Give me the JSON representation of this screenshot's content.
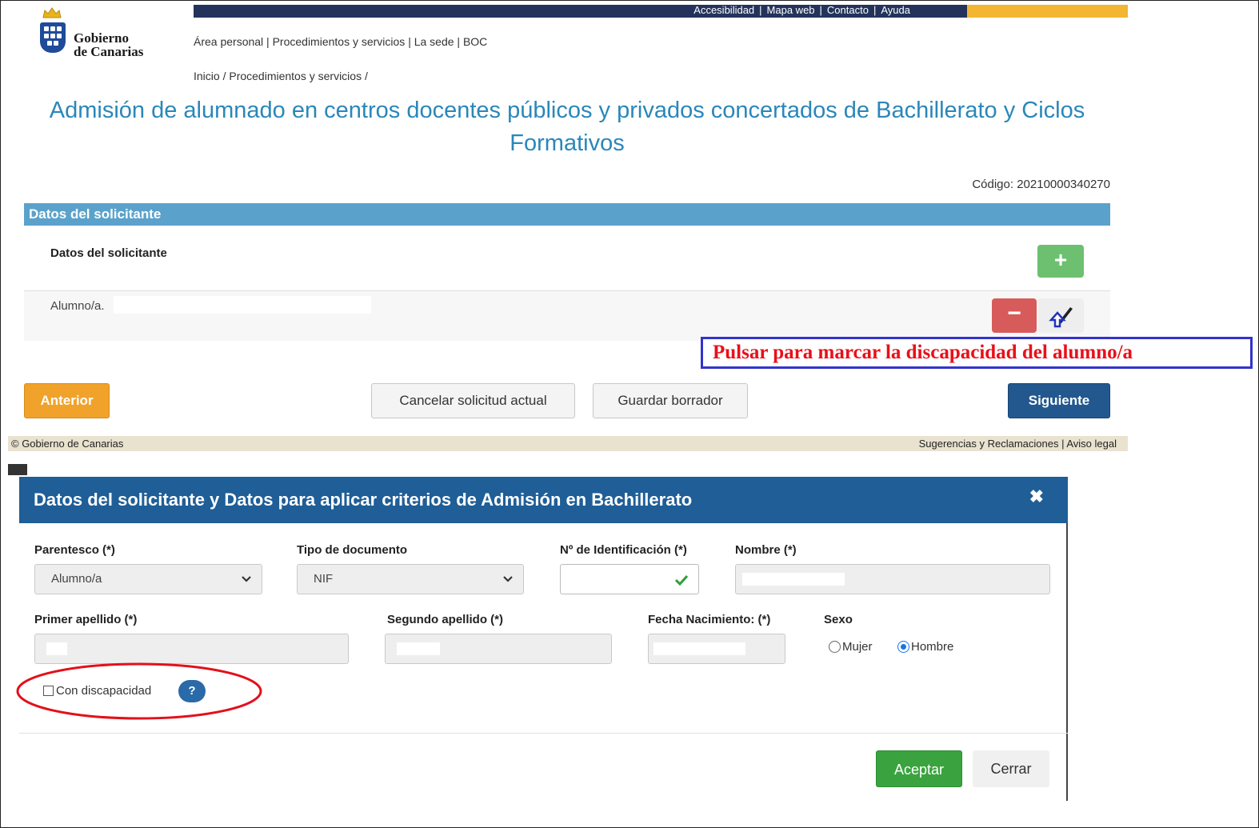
{
  "header": {
    "top_links": [
      "Accesibilidad",
      "Mapa web",
      "Contacto",
      "Ayuda"
    ],
    "logo_line1": "Gobierno",
    "logo_line2": "de Canarias",
    "nav_links": "Área personal | Procedimientos y servicios | La sede | BOC",
    "breadcrumb": "Inicio / Procedimientos y servicios /",
    "colors": {
      "topbar": "#23335c",
      "accent": "#f2b632",
      "title": "#2a87b9"
    }
  },
  "page": {
    "title": "Admisión de alumnado en centros docentes públicos y privados concertados de Bachillerato y Ciclos Formativos",
    "code": "Código: 20210000340270"
  },
  "section": {
    "header": "Datos del solicitante",
    "subheader": "Datos del solicitante",
    "add_icon": "+",
    "applicant_label": "Alumno/a.",
    "remove_icon": "−"
  },
  "callout": {
    "text": "Pulsar para marcar la discapacidad del alumno/a"
  },
  "actions": {
    "prev": "Anterior",
    "cancel": "Cancelar solicitud actual",
    "draft": "Guardar borrador",
    "next": "Siguiente"
  },
  "footer": {
    "left": "© Gobierno de Canarias",
    "right": "Sugerencias y Reclamaciones | Aviso legal"
  },
  "modal": {
    "title": "Datos del solicitante y Datos para aplicar criterios de Admisión en Bachillerato",
    "close_icon": "✖",
    "fields": {
      "parentesco": {
        "label": "Parentesco (*)",
        "value": "Alumno/a"
      },
      "tipo_documento": {
        "label": "Tipo de documento",
        "value": "NIF"
      },
      "identificacion": {
        "label": "Nº de Identificación (*)",
        "value": ""
      },
      "nombre": {
        "label": "Nombre (*)",
        "value": ""
      },
      "primer_apellido": {
        "label": "Primer apellido (*)",
        "value": ""
      },
      "segundo_apellido": {
        "label": "Segundo apellido (*)",
        "value": ""
      },
      "fecha_nacimiento": {
        "label": "Fecha Nacimiento: (*)",
        "value": ""
      },
      "sexo": {
        "label": "Sexo",
        "options": [
          "Mujer",
          "Hombre"
        ],
        "selected": "Hombre"
      }
    },
    "discapacidad": {
      "label": "Con discapacidad",
      "checked": false,
      "help_icon": "?"
    },
    "buttons": {
      "accept": "Aceptar",
      "close": "Cerrar"
    }
  }
}
